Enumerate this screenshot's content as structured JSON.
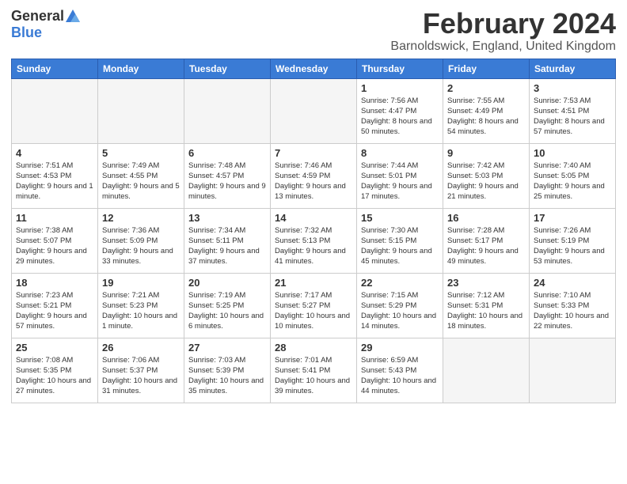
{
  "header": {
    "logo_general": "General",
    "logo_blue": "Blue",
    "title": "February 2024",
    "subtitle": "Barnoldswick, England, United Kingdom"
  },
  "weekdays": [
    "Sunday",
    "Monday",
    "Tuesday",
    "Wednesday",
    "Thursday",
    "Friday",
    "Saturday"
  ],
  "weeks": [
    [
      {
        "day": "",
        "info": ""
      },
      {
        "day": "",
        "info": ""
      },
      {
        "day": "",
        "info": ""
      },
      {
        "day": "",
        "info": ""
      },
      {
        "day": "1",
        "info": "Sunrise: 7:56 AM\nSunset: 4:47 PM\nDaylight: 8 hours\nand 50 minutes."
      },
      {
        "day": "2",
        "info": "Sunrise: 7:55 AM\nSunset: 4:49 PM\nDaylight: 8 hours\nand 54 minutes."
      },
      {
        "day": "3",
        "info": "Sunrise: 7:53 AM\nSunset: 4:51 PM\nDaylight: 8 hours\nand 57 minutes."
      }
    ],
    [
      {
        "day": "4",
        "info": "Sunrise: 7:51 AM\nSunset: 4:53 PM\nDaylight: 9 hours\nand 1 minute."
      },
      {
        "day": "5",
        "info": "Sunrise: 7:49 AM\nSunset: 4:55 PM\nDaylight: 9 hours\nand 5 minutes."
      },
      {
        "day": "6",
        "info": "Sunrise: 7:48 AM\nSunset: 4:57 PM\nDaylight: 9 hours\nand 9 minutes."
      },
      {
        "day": "7",
        "info": "Sunrise: 7:46 AM\nSunset: 4:59 PM\nDaylight: 9 hours\nand 13 minutes."
      },
      {
        "day": "8",
        "info": "Sunrise: 7:44 AM\nSunset: 5:01 PM\nDaylight: 9 hours\nand 17 minutes."
      },
      {
        "day": "9",
        "info": "Sunrise: 7:42 AM\nSunset: 5:03 PM\nDaylight: 9 hours\nand 21 minutes."
      },
      {
        "day": "10",
        "info": "Sunrise: 7:40 AM\nSunset: 5:05 PM\nDaylight: 9 hours\nand 25 minutes."
      }
    ],
    [
      {
        "day": "11",
        "info": "Sunrise: 7:38 AM\nSunset: 5:07 PM\nDaylight: 9 hours\nand 29 minutes."
      },
      {
        "day": "12",
        "info": "Sunrise: 7:36 AM\nSunset: 5:09 PM\nDaylight: 9 hours\nand 33 minutes."
      },
      {
        "day": "13",
        "info": "Sunrise: 7:34 AM\nSunset: 5:11 PM\nDaylight: 9 hours\nand 37 minutes."
      },
      {
        "day": "14",
        "info": "Sunrise: 7:32 AM\nSunset: 5:13 PM\nDaylight: 9 hours\nand 41 minutes."
      },
      {
        "day": "15",
        "info": "Sunrise: 7:30 AM\nSunset: 5:15 PM\nDaylight: 9 hours\nand 45 minutes."
      },
      {
        "day": "16",
        "info": "Sunrise: 7:28 AM\nSunset: 5:17 PM\nDaylight: 9 hours\nand 49 minutes."
      },
      {
        "day": "17",
        "info": "Sunrise: 7:26 AM\nSunset: 5:19 PM\nDaylight: 9 hours\nand 53 minutes."
      }
    ],
    [
      {
        "day": "18",
        "info": "Sunrise: 7:23 AM\nSunset: 5:21 PM\nDaylight: 9 hours\nand 57 minutes."
      },
      {
        "day": "19",
        "info": "Sunrise: 7:21 AM\nSunset: 5:23 PM\nDaylight: 10 hours\nand 1 minute."
      },
      {
        "day": "20",
        "info": "Sunrise: 7:19 AM\nSunset: 5:25 PM\nDaylight: 10 hours\nand 6 minutes."
      },
      {
        "day": "21",
        "info": "Sunrise: 7:17 AM\nSunset: 5:27 PM\nDaylight: 10 hours\nand 10 minutes."
      },
      {
        "day": "22",
        "info": "Sunrise: 7:15 AM\nSunset: 5:29 PM\nDaylight: 10 hours\nand 14 minutes."
      },
      {
        "day": "23",
        "info": "Sunrise: 7:12 AM\nSunset: 5:31 PM\nDaylight: 10 hours\nand 18 minutes."
      },
      {
        "day": "24",
        "info": "Sunrise: 7:10 AM\nSunset: 5:33 PM\nDaylight: 10 hours\nand 22 minutes."
      }
    ],
    [
      {
        "day": "25",
        "info": "Sunrise: 7:08 AM\nSunset: 5:35 PM\nDaylight: 10 hours\nand 27 minutes."
      },
      {
        "day": "26",
        "info": "Sunrise: 7:06 AM\nSunset: 5:37 PM\nDaylight: 10 hours\nand 31 minutes."
      },
      {
        "day": "27",
        "info": "Sunrise: 7:03 AM\nSunset: 5:39 PM\nDaylight: 10 hours\nand 35 minutes."
      },
      {
        "day": "28",
        "info": "Sunrise: 7:01 AM\nSunset: 5:41 PM\nDaylight: 10 hours\nand 39 minutes."
      },
      {
        "day": "29",
        "info": "Sunrise: 6:59 AM\nSunset: 5:43 PM\nDaylight: 10 hours\nand 44 minutes."
      },
      {
        "day": "",
        "info": ""
      },
      {
        "day": "",
        "info": ""
      }
    ]
  ]
}
